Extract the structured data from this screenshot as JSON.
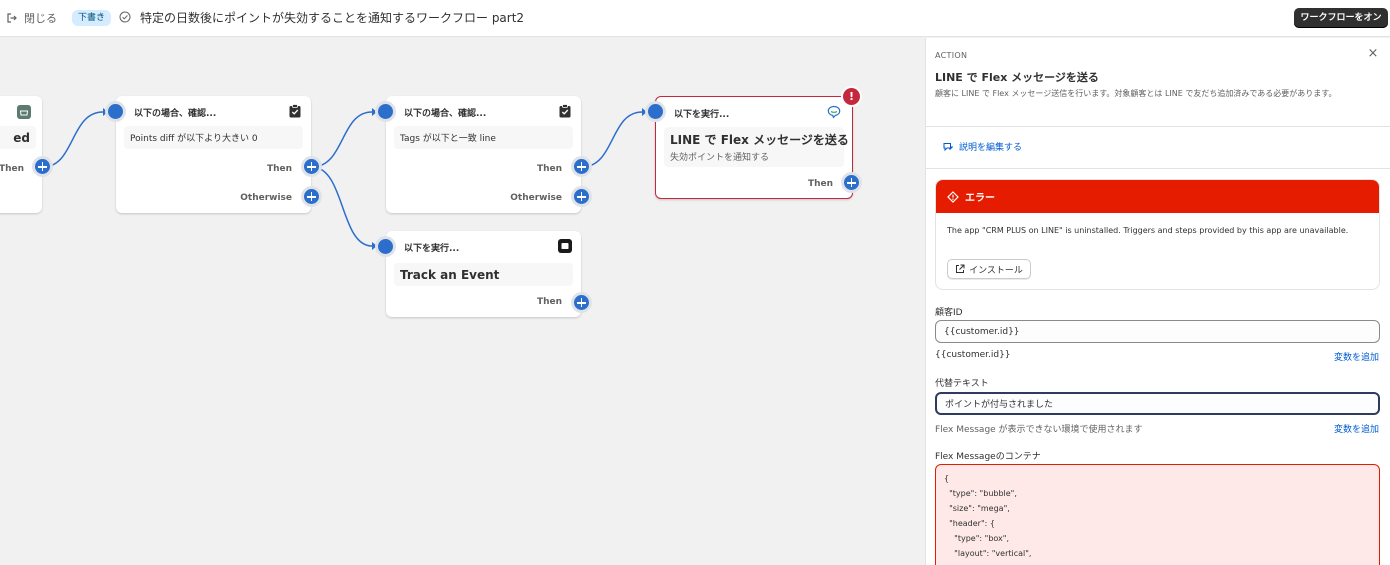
{
  "topbar": {
    "close_label": "閉じる",
    "draft_badge": "下書き",
    "title": "特定の日数後にポイントが失効することを通知するワークフロー part2",
    "turn_on_label": "ワークフローをオン"
  },
  "canvas": {
    "left_card": {
      "text_fragment": "ed",
      "then_label": "Then"
    },
    "condition_1": {
      "header": "以下の場合、確認...",
      "body": "Points diff が以下より大きい 0",
      "then_label": "Then",
      "otherwise_label": "Otherwise"
    },
    "condition_2": {
      "header": "以下の場合、確認...",
      "body": "Tags が以下と一致 line",
      "then_label": "Then",
      "otherwise_label": "Otherwise"
    },
    "action_line": {
      "header": "以下を実行...",
      "title": "LINE で Flex メッセージを送る",
      "subtitle": "失効ポイントを通知する",
      "then_label": "Then",
      "error_mark": "!"
    },
    "action_track": {
      "header": "以下を実行...",
      "title": "Track an Event",
      "then_label": "Then"
    }
  },
  "panel": {
    "section_label": "ACTION",
    "close_glyph": "×",
    "title": "LINE で Flex メッセージを送る",
    "description": "顧客に LINE で Flex メッセージ送信を行います。対象顧客とは LINE で友だち追加済みである必要があります。",
    "edit_description_link": "説明を編集する",
    "error": {
      "title": "エラー",
      "message": "The app \"CRM PLUS on LINE\" is uninstalled. Triggers and steps provided by this app are unavailable.",
      "install_label": "インストール"
    },
    "customer_id": {
      "label": "顧客ID",
      "value": "{{customer.id}}",
      "help": "{{customer.id}}",
      "add_variable": "変数を追加"
    },
    "alt_text": {
      "label": "代替テキスト",
      "value": "ポイントが付与されました",
      "help": "Flex Message が表示できない環境で使用されます",
      "add_variable": "変数を追加"
    },
    "flex_container": {
      "label": "Flex Messageのコンテナ",
      "code": "{\n  \"type\": \"bubble\",\n  \"size\": \"mega\",\n  \"header\": {\n    \"type\": \"box\",\n    \"layout\": \"vertical\","
    }
  },
  "colors": {
    "accent_blue": "#2c6ecb",
    "error_red": "#e51c00",
    "card_error_border": "#c5283d",
    "link_blue": "#005bd3"
  }
}
